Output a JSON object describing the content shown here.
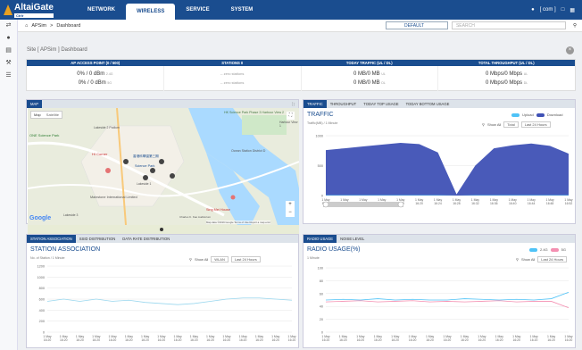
{
  "header": {
    "brand": "AltaiGate",
    "brand_sub": "Ctrlr",
    "nav": [
      "NETWORK",
      "WIRELESS",
      "SERVICE",
      "SYSTEM"
    ],
    "active_nav": "WIRELESS",
    "user": "[ com ]"
  },
  "breadcrumb": {
    "site": "APSim",
    "page": "Dashboard",
    "group_select": "DEFAULT",
    "search_placeholder": "SEARCH"
  },
  "site_title": "Site [ APSim ] Dashboard",
  "stats": {
    "headers": [
      "AP ACCESS POINT (0 / 500)",
      "STATIONS 0",
      "TODAY TRAFFIC (UL / DL)",
      "TOTAL THROUGHPUT (UL / DL)"
    ],
    "ap": [
      "0% / 0 dBm",
      "0% / 0 dBm"
    ],
    "ap_units": [
      "2.4G",
      "5G"
    ],
    "stations": [
      "-- zero stations",
      "-- zero stations"
    ],
    "today_traffic": [
      "0 MB/0 MB",
      "0 MB/0 MB"
    ],
    "traffic_units": [
      "UL",
      "DL"
    ],
    "throughput": [
      "0 Mbps/0 Mbps",
      "0 Mbps/0 Mbps"
    ],
    "throughput_units": [
      "UL",
      "DL"
    ]
  },
  "map": {
    "tab": "MAP",
    "map_types": [
      "Map",
      "Satellite"
    ],
    "places": [
      "HK Science Park Phase 3 Harbour View 2",
      "Lakeside 2 Podium",
      "HI Corner",
      "香港科學園第三期",
      "Science Park",
      "Lakeside 1",
      "ONE Science Park",
      "Mainstone International Limited",
      "Sing Mei House",
      "Charles K. Kao Auditorium",
      "Ocean Station District D",
      "Harbour View 1",
      "Lakeside 3"
    ],
    "google": "Google",
    "footer": "Map data ©2019 Google   Terms of Use   Report a map error"
  },
  "traffic": {
    "tabs": [
      "TRAFFIC",
      "THROUGHPUT",
      "TODAY TOP USAGE",
      "TODAY BOTTOM USAGE"
    ],
    "title": "TRAFFIC",
    "subtitle": "Traffic(MB) / 1 Minute",
    "show_all": "Show All",
    "sel1": "Total",
    "sel2": "Last 24 Hours",
    "legend": [
      "Upload",
      "Download"
    ],
    "colors": {
      "upload": "#4fc3f7",
      "download": "#3f51b5"
    }
  },
  "station": {
    "tabs": [
      "STATION ASSOCIATION",
      "SSID DISTRIBUTION",
      "DATA RATE DISTRIBUTION"
    ],
    "title": "STATION ASSOCIATION",
    "subtitle": "No. of Station / 1 Minute",
    "show_all": "Show All",
    "sel1": "WLAN",
    "sel2": "Last 24 Hours"
  },
  "radio": {
    "tabs": [
      "RADIO USAGE",
      "NOISE LEVEL"
    ],
    "title": "RADIO USAGE(%)",
    "subtitle": "1 Minute",
    "show_all": "Show All",
    "sel": "Last 24 Hours",
    "legend": [
      "2.4G",
      "5G"
    ],
    "colors": {
      "g24": "#4fc3f7",
      "g5": "#f48fb1"
    }
  },
  "chart_data": [
    {
      "type": "area",
      "title": "TRAFFIC",
      "ylabel": "Traffic(MB) / 1 Minute",
      "ylim": [
        0,
        1000
      ],
      "yticks": [
        0,
        500,
        1000
      ],
      "x": [
        "1 May 16:01",
        "1 May 16:04",
        "1 May 16:08",
        "1 May 16:12",
        "1 May 16:16",
        "1 May 16:20",
        "1 May 16:24",
        "1 May 16:28",
        "1 May 16:32",
        "1 May 16:36",
        "1 May 16:40",
        "1 May 16:44",
        "1 May 16:48",
        "1 May 16:52"
      ],
      "series": [
        {
          "name": "Download",
          "values": [
            760,
            790,
            820,
            850,
            880,
            860,
            720,
            20,
            500,
            790,
            840,
            870,
            830,
            700
          ]
        },
        {
          "name": "Upload",
          "values": [
            8,
            8,
            8,
            8,
            8,
            8,
            8,
            0,
            8,
            8,
            8,
            8,
            8,
            8
          ]
        }
      ]
    },
    {
      "type": "line",
      "title": "STATION ASSOCIATION",
      "ylabel": "No. of Station / 1 Minute",
      "ylim": [
        0,
        1200
      ],
      "yticks": [
        0,
        200,
        400,
        600,
        800,
        1000,
        1200
      ],
      "x": [
        "1 May 16:20",
        "1 May 16:20",
        "1 May 16:20",
        "1 May 16:20",
        "1 May 16:20",
        "1 May 16:20",
        "1 May 16:20",
        "1 May 16:20",
        "1 May 16:20",
        "1 May 16:20",
        "1 May 16:20",
        "1 May 16:20",
        "1 May 16:20",
        "1 May 16:20",
        "1 May 16:20",
        "1 May 16:20"
      ],
      "series": [
        {
          "name": "WLAN",
          "values": [
            560,
            600,
            560,
            600,
            560,
            580,
            540,
            520,
            500,
            520,
            560,
            600,
            620,
            620,
            600,
            580
          ]
        }
      ]
    },
    {
      "type": "line",
      "title": "RADIO USAGE(%)",
      "ylim": [
        0,
        100
      ],
      "yticks": [
        0,
        20,
        40,
        60,
        80,
        100
      ],
      "x": [
        "1 May 16:20",
        "1 May 16:20",
        "1 May 16:20",
        "1 May 16:20",
        "1 May 16:20",
        "1 May 16:20",
        "1 May 16:20",
        "1 May 16:20",
        "1 May 16:20",
        "1 May 16:20",
        "1 May 16:20",
        "1 May 16:20",
        "1 May 16:20",
        "1 May 16:20",
        "1 May 16:20"
      ],
      "series": [
        {
          "name": "2.4G",
          "values": [
            50,
            51,
            50,
            52,
            50,
            51,
            50,
            50,
            52,
            51,
            50,
            51,
            50,
            52,
            62
          ]
        },
        {
          "name": "5G",
          "values": [
            47,
            48,
            49,
            47,
            48,
            49,
            47,
            48,
            47,
            48,
            49,
            47,
            48,
            48,
            38
          ]
        }
      ]
    }
  ]
}
